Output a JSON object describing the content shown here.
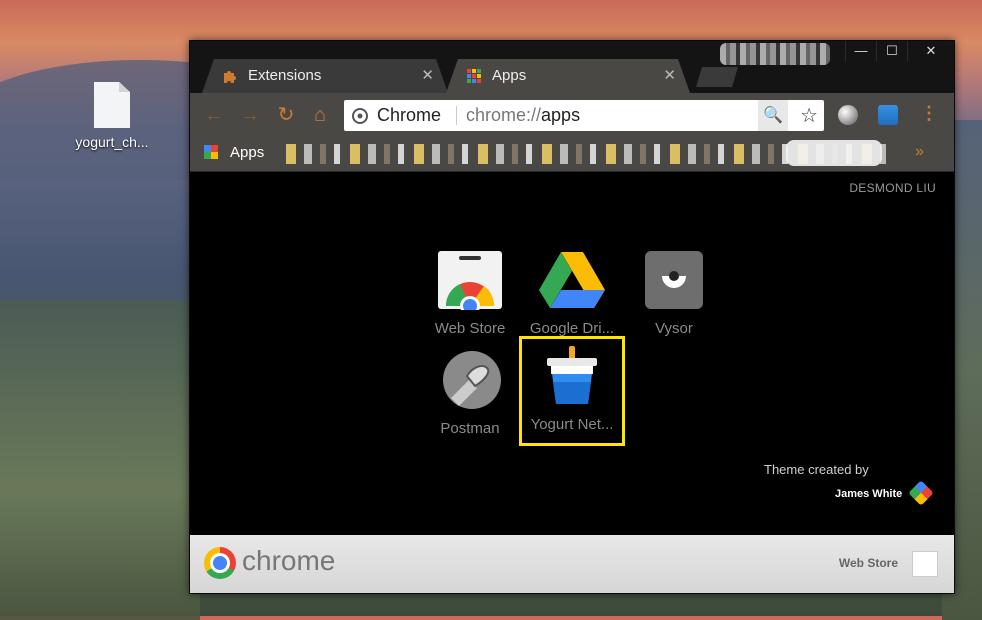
{
  "desktop": {
    "file_label": "yogurt_ch..."
  },
  "window": {
    "tabs": [
      {
        "label": "Extensions",
        "icon": "puzzle-icon",
        "active": false
      },
      {
        "label": "Apps",
        "icon": "apps-grid-icon",
        "active": true
      }
    ],
    "controls": {
      "minimize": "—",
      "maximize": "☐",
      "close": "✕"
    }
  },
  "toolbar": {
    "back": "←",
    "forward": "→",
    "reload": "↻",
    "home": "⌂",
    "site_chip": "Chrome",
    "url_scheme": "chrome://",
    "url_host": "apps",
    "zoom": "🔍",
    "star": "☆",
    "menu": "⋮"
  },
  "bookmarks": {
    "apps_label": "Apps",
    "more": "»"
  },
  "apps_page": {
    "user": "DESMOND LIU",
    "apps": [
      {
        "name": "Web Store",
        "icon": "web-store-icon"
      },
      {
        "name": "Google Dri...",
        "icon": "google-drive-icon"
      },
      {
        "name": "Vysor",
        "icon": "vysor-icon"
      },
      {
        "name": "Postman",
        "icon": "postman-icon"
      },
      {
        "name": "Yogurt Net...",
        "icon": "yogurt-icon"
      }
    ],
    "theme_credit": "Theme created by",
    "theme_author": "James White"
  },
  "footer": {
    "chrome_word": "chrome",
    "web_store": "Web Store"
  },
  "colors": {
    "accent": "#d07a2e",
    "highlight": "#ffe600"
  }
}
